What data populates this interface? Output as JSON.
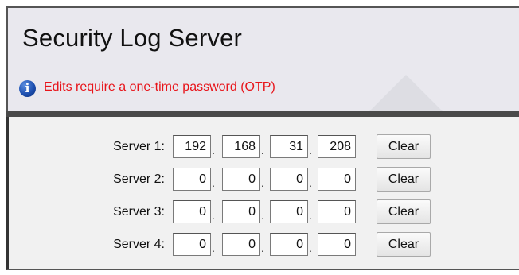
{
  "page": {
    "title": "Security Log Server",
    "notice": "Edits require a one-time password (OTP)",
    "notice_icon": "info-icon",
    "notice_color": "#e8141a"
  },
  "servers": [
    {
      "label": "Server 1:",
      "octets": [
        "192",
        "168",
        "31",
        "208"
      ],
      "clear_label": "Clear"
    },
    {
      "label": "Server 2:",
      "octets": [
        "0",
        "0",
        "0",
        "0"
      ],
      "clear_label": "Clear"
    },
    {
      "label": "Server 3:",
      "octets": [
        "0",
        "0",
        "0",
        "0"
      ],
      "clear_label": "Clear"
    },
    {
      "label": "Server 4:",
      "octets": [
        "0",
        "0",
        "0",
        "0"
      ],
      "clear_label": "Clear"
    }
  ]
}
